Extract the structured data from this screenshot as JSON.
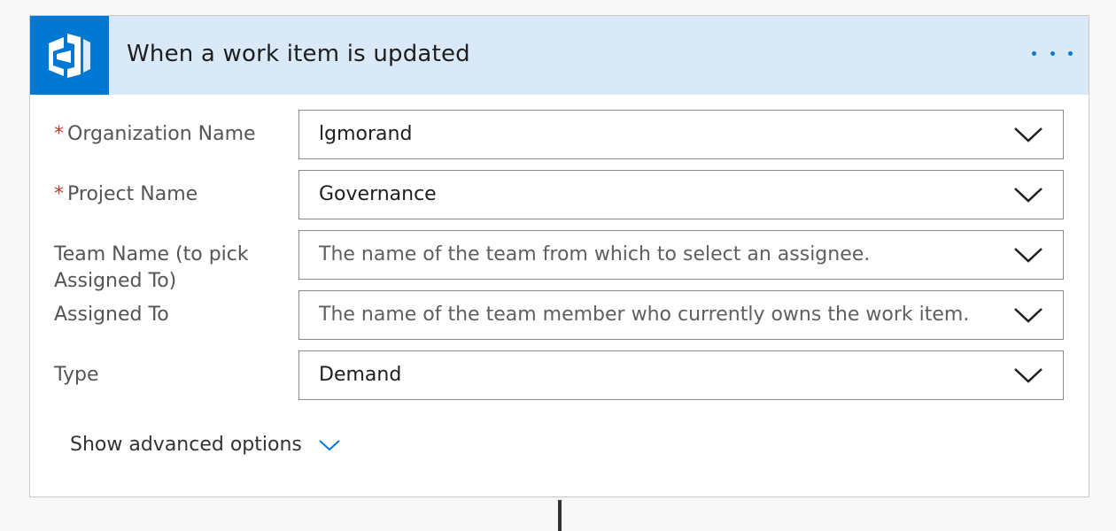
{
  "trigger": {
    "title": "When a work item is updated",
    "icon": "azure-devops-icon",
    "accent_color": "#0078d4",
    "header_bg": "#d9e9f8"
  },
  "fields": {
    "organization": {
      "label": "Organization Name",
      "required": true,
      "value": "lgmorand"
    },
    "project": {
      "label": "Project Name",
      "required": true,
      "value": "Governance"
    },
    "team": {
      "label_line1": "Team Name (to pick",
      "label_line2": "Assigned To)",
      "required": false,
      "placeholder": "The name of the team from which to select an assignee."
    },
    "assigned": {
      "label": "Assigned To",
      "required": false,
      "placeholder": "The name of the team member who currently owns the work item."
    },
    "type": {
      "label": "Type",
      "required": false,
      "value": "Demand"
    }
  },
  "advanced": {
    "label": "Show advanced options"
  },
  "required_marker": "*"
}
